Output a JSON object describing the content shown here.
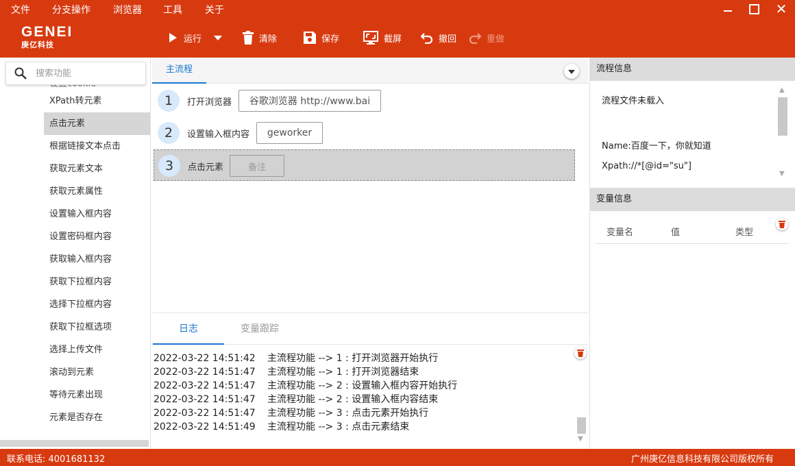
{
  "menu": {
    "items": [
      "文件",
      "分支操作",
      "浏览器",
      "工具",
      "关于"
    ]
  },
  "window": {
    "minimize": "minimize-icon",
    "maximize": "maximize-icon",
    "close": "✕"
  },
  "toolbar": {
    "logo": {
      "brand": "GENEI",
      "brand_cn": "庚亿科技"
    },
    "buttons": [
      {
        "label": "运行",
        "icon": "play-icon",
        "enabled": true
      },
      {
        "label": "清除",
        "icon": "trash-icon",
        "enabled": true
      },
      {
        "label": "保存",
        "icon": "save-icon",
        "enabled": true
      },
      {
        "label": "截屏",
        "icon": "screenshot-icon",
        "enabled": true
      },
      {
        "label": "撤回",
        "icon": "undo-icon",
        "enabled": true
      },
      {
        "label": "重做",
        "icon": "redo-icon",
        "enabled": false
      }
    ]
  },
  "sidebar": {
    "search_placeholder": "搜索功能",
    "items": [
      {
        "label": "设置cookie",
        "selected": false
      },
      {
        "label": "XPath转元素",
        "selected": false
      },
      {
        "label": "点击元素",
        "selected": true
      },
      {
        "label": "根据链接文本点击",
        "selected": false
      },
      {
        "label": "获取元素文本",
        "selected": false
      },
      {
        "label": "获取元素属性",
        "selected": false
      },
      {
        "label": "设置输入框内容",
        "selected": false
      },
      {
        "label": "设置密码框内容",
        "selected": false
      },
      {
        "label": "获取输入框内容",
        "selected": false
      },
      {
        "label": "获取下拉框内容",
        "selected": false
      },
      {
        "label": "选择下拉框内容",
        "selected": false
      },
      {
        "label": "获取下拉框选项",
        "selected": false
      },
      {
        "label": "选择上传文件",
        "selected": false
      },
      {
        "label": "滚动到元素",
        "selected": false
      },
      {
        "label": "等待元素出现",
        "selected": false
      },
      {
        "label": "元素是否存在",
        "selected": false
      }
    ]
  },
  "flow": {
    "tab": "主流程",
    "steps": [
      {
        "num": "1",
        "label": "打开浏览器",
        "value": "谷歌浏览器 http://www.bai",
        "active": false
      },
      {
        "num": "2",
        "label": "设置输入框内容",
        "value": "geworker",
        "active": false
      },
      {
        "num": "3",
        "label": "点击元素",
        "value": "备注",
        "active": true
      }
    ]
  },
  "log": {
    "tabs": [
      "日志",
      "变量跟踪"
    ],
    "active_tab": 0,
    "lines": [
      {
        "time": "2022-03-22 14:51:42",
        "text": "主流程功能 --> 1 : 打开浏览器开始执行"
      },
      {
        "time": "2022-03-22 14:51:47",
        "text": "主流程功能 --> 1 : 打开浏览器结束"
      },
      {
        "time": "2022-03-22 14:51:47",
        "text": "主流程功能 --> 2 : 设置输入框内容开始执行"
      },
      {
        "time": "2022-03-22 14:51:47",
        "text": "主流程功能 --> 2 : 设置输入框内容结束"
      },
      {
        "time": "2022-03-22 14:51:47",
        "text": "主流程功能 --> 3 : 点击元素开始执行"
      },
      {
        "time": "2022-03-22 14:51:49",
        "text": "主流程功能 --> 3 : 点击元素结束"
      }
    ]
  },
  "flow_info": {
    "title": "流程信息",
    "status": "流程文件未载入",
    "name_line": "Name:百度一下，你就知道",
    "xpath_line": "Xpath://*[@id=\"su\"]"
  },
  "var_info": {
    "title": "变量信息",
    "columns": [
      "变量名",
      "值",
      "类型"
    ]
  },
  "status": {
    "phone": "联系电话:   4001681132",
    "copyright": "广州庚亿信息科技有限公司版权所有"
  },
  "colors": {
    "accent": "#d83a10",
    "tab_blue": "#1976d2",
    "step_circle": "#d7e9fb"
  }
}
